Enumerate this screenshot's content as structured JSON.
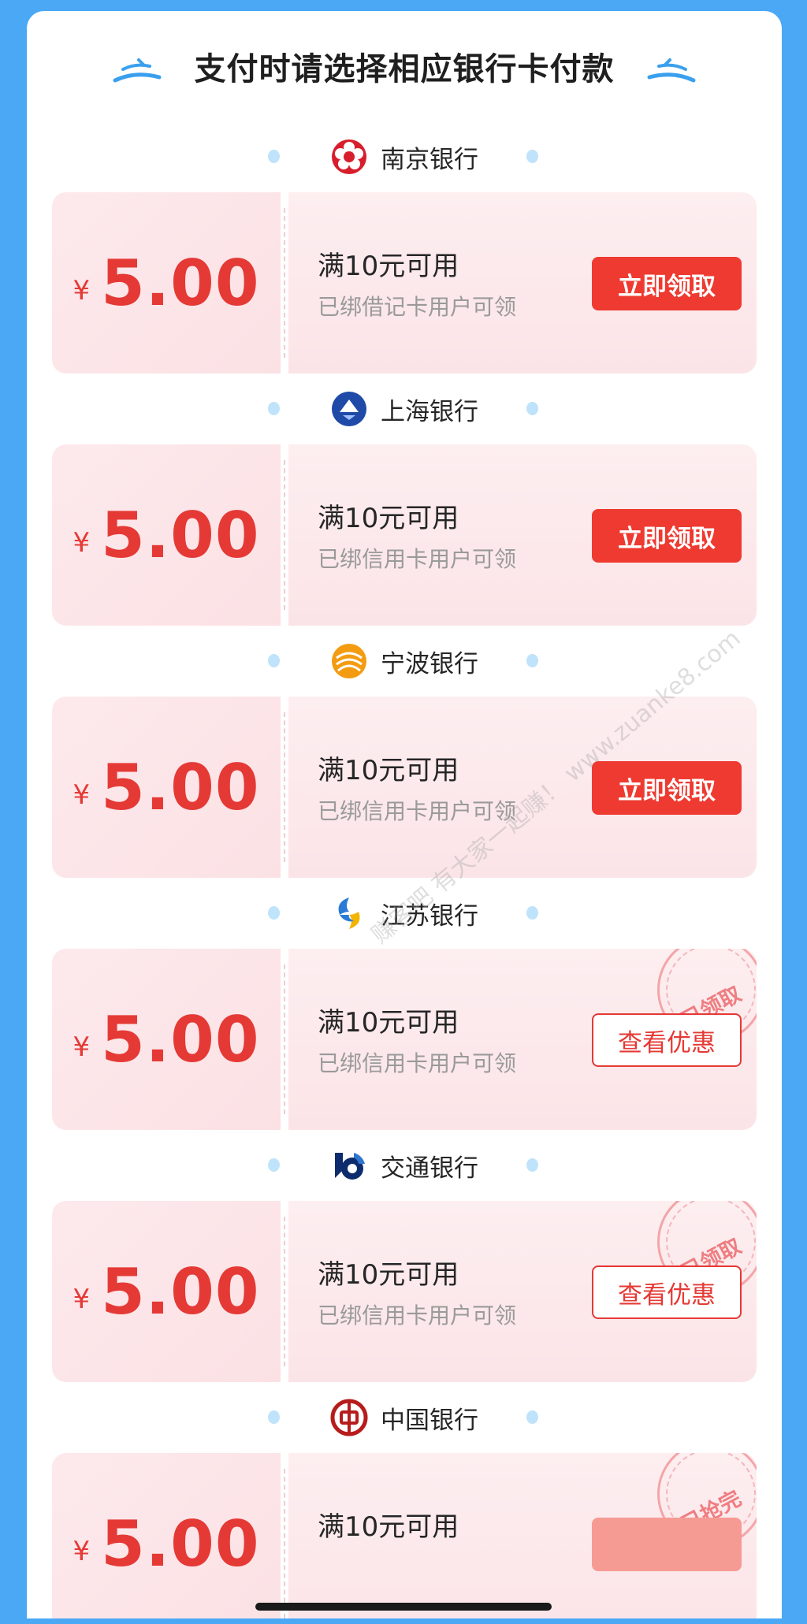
{
  "page": {
    "title": "支付时请选择相应银行卡付款",
    "watermark": "赚客吧 有大家一起赚！ www.zuanke8.com"
  },
  "colors": {
    "background": "#4aa8f5",
    "accent_red": "#e53935",
    "button_red": "#ee3a30",
    "coupon_bg": "#fde9ec"
  },
  "sections": [
    {
      "bank_name": "南京银行",
      "logo_icon": "nanjing-bank-flower-icon",
      "currency": "¥",
      "amount": "5.00",
      "condition": "满10元可用",
      "eligibility": "已绑借记卡用户可领",
      "button_label": "立即领取",
      "button_style": "primary",
      "stamp": ""
    },
    {
      "bank_name": "上海银行",
      "logo_icon": "shanghai-bank-icon",
      "currency": "¥",
      "amount": "5.00",
      "condition": "满10元可用",
      "eligibility": "已绑信用卡用户可领",
      "button_label": "立即领取",
      "button_style": "primary",
      "stamp": ""
    },
    {
      "bank_name": "宁波银行",
      "logo_icon": "ningbo-bank-icon",
      "currency": "¥",
      "amount": "5.00",
      "condition": "满10元可用",
      "eligibility": "已绑信用卡用户可领",
      "button_label": "立即领取",
      "button_style": "primary",
      "stamp": ""
    },
    {
      "bank_name": "江苏银行",
      "logo_icon": "jiangsu-bank-icon",
      "currency": "¥",
      "amount": "5.00",
      "condition": "满10元可用",
      "eligibility": "已绑信用卡用户可领",
      "button_label": "查看优惠",
      "button_style": "outline",
      "stamp": "已领取"
    },
    {
      "bank_name": "交通银行",
      "logo_icon": "bankcomm-icon",
      "currency": "¥",
      "amount": "5.00",
      "condition": "满10元可用",
      "eligibility": "已绑信用卡用户可领",
      "button_label": "查看优惠",
      "button_style": "outline",
      "stamp": "已领取"
    },
    {
      "bank_name": "中国银行",
      "logo_icon": "bank-of-china-icon",
      "currency": "¥",
      "amount": "5.00",
      "condition": "满10元可用",
      "eligibility": "",
      "button_label": "",
      "button_style": "disabled",
      "stamp": "已抢完"
    }
  ]
}
